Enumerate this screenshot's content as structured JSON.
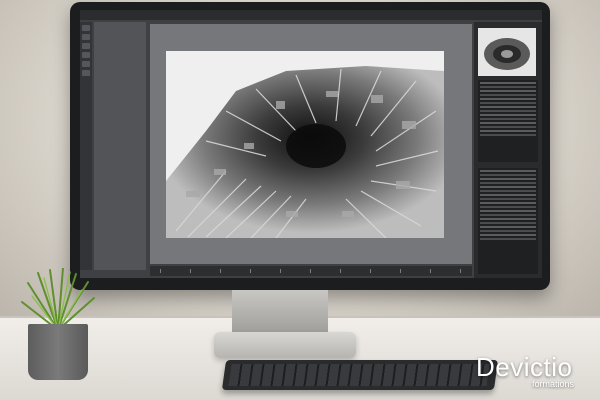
{
  "app": {
    "title": ""
  },
  "watermark": {
    "main": "Devictio",
    "sub": "formations"
  },
  "colors": {
    "ui_dark": "#2b2c2e",
    "viewport_gray": "#75777a",
    "desk": "#f1eeea"
  }
}
